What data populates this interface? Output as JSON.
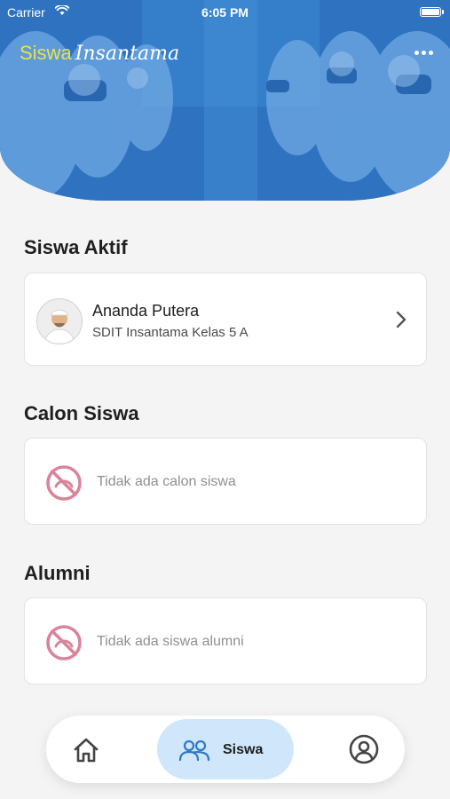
{
  "status_bar": {
    "carrier": "Carrier",
    "time": "6:05 PM"
  },
  "header": {
    "brand_word1": "Siswa",
    "brand_word2": "Insantama",
    "menu_icon": "more-horizontal-icon"
  },
  "sections": {
    "active": {
      "title": "Siswa Aktif",
      "student": {
        "name": "Ananda Putera",
        "class": "SDIT Insantama Kelas 5 A"
      }
    },
    "candidates": {
      "title": "Calon Siswa",
      "empty_text": "Tidak ada calon siswa"
    },
    "alumni": {
      "title": "Alumni",
      "empty_text": "Tidak ada siswa alumni"
    }
  },
  "nav": {
    "items": [
      {
        "icon": "home-icon",
        "label": ""
      },
      {
        "icon": "users-icon",
        "label": "Siswa",
        "active": true
      },
      {
        "icon": "user-circle-icon",
        "label": ""
      }
    ]
  },
  "colors": {
    "brand_yellow": "#e8e34a",
    "header_blue": "#2f74c2",
    "active_nav_bg": "#cfe6fb",
    "empty_icon": "#d9849a"
  }
}
